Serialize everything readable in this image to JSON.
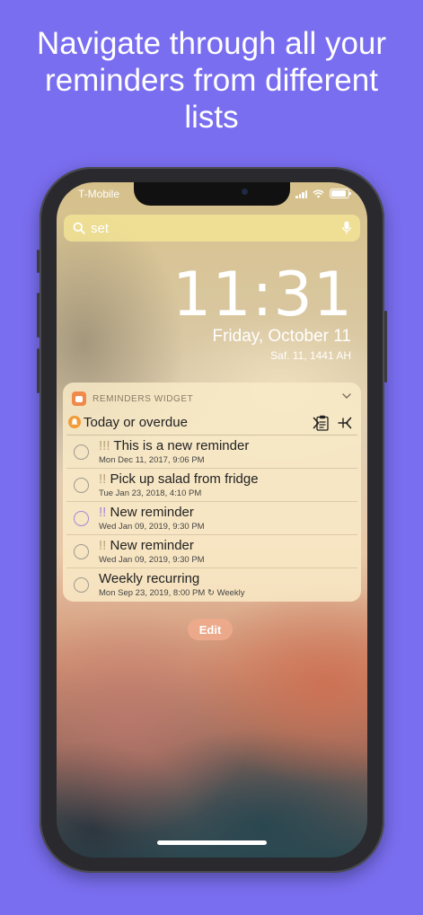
{
  "headline": {
    "line1": "Navigate through all your",
    "line2": "reminders from different",
    "line3": "lists"
  },
  "status_bar": {
    "carrier": "T-Mobile"
  },
  "search": {
    "value": "set"
  },
  "lock_screen": {
    "time": "11:31",
    "date": "Friday, October 11",
    "hijri_date": "Saf. 11, 1441 AH"
  },
  "widget": {
    "title": "REMINDERS WIDGET",
    "list_name": "Today or overdue",
    "toolbar_plus": "+",
    "reminders": [
      {
        "priority": "!!!",
        "priority_color": "#b9a27a",
        "title": "This is a new reminder",
        "subtitle": "Mon Dec 11, 2017, 9:06 PM"
      },
      {
        "priority": "!!",
        "priority_color": "#b9a27a",
        "title": "Pick up salad from fridge",
        "subtitle": "Tue Jan 23, 2018, 4:10 PM"
      },
      {
        "priority": "!!",
        "priority_color": "#a985d8",
        "title": "New reminder",
        "subtitle": "Wed Jan 09, 2019, 9:30 PM"
      },
      {
        "priority": "!!",
        "priority_color": "#b9a27a",
        "title": "New reminder",
        "subtitle": "Wed Jan 09, 2019, 9:30 PM"
      },
      {
        "priority": "",
        "priority_color": "#b9a27a",
        "title": "Weekly recurring",
        "subtitle": "Mon Sep 23, 2019, 8:00 PM",
        "repeat": "Weekly"
      }
    ]
  },
  "edit_button": {
    "label": "Edit"
  },
  "colors": {
    "background": "#7a6ef0",
    "accent": "#f29b37"
  },
  "icons": [
    "search-icon",
    "mic-icon",
    "signal-icon",
    "wifi-icon",
    "battery-icon",
    "reminders-app-icon",
    "chevron-down-icon",
    "bell-icon",
    "clipboard-icon",
    "chevron-left-icon",
    "chevron-right-icon",
    "plus-icon",
    "repeat-icon"
  ]
}
